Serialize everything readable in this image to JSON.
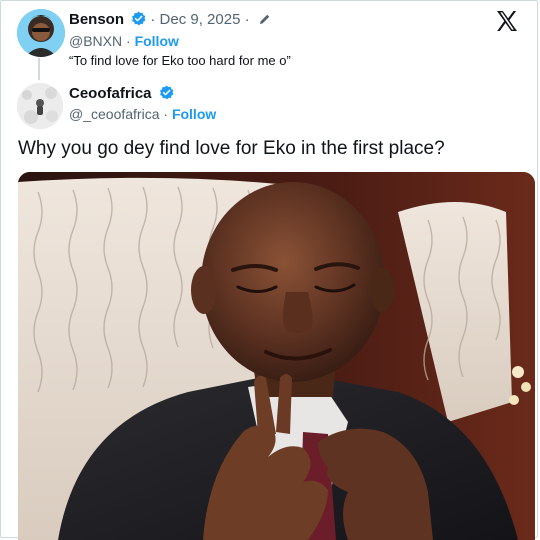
{
  "reply": {
    "name": "Benson",
    "date": "Dec 9, 2025",
    "separator": "·",
    "handle": "@BNXN",
    "follow_label": "Follow",
    "text": "“To find love for Eko too hard for me o”"
  },
  "tweet": {
    "name": "Ceoofafrica",
    "handle": "@_ceoofafrica",
    "separator": "·",
    "follow_label": "Follow",
    "text": "Why you go dey find love for Eko in the first place?"
  },
  "icons": {
    "brand": "x-logo-icon",
    "verified": "verified-badge-icon",
    "edited": "pencil-icon"
  },
  "colors": {
    "link": "#1d9bf0",
    "verified": "#1d9bf0",
    "muted": "#536471",
    "text": "#0f1419",
    "border": "#cfd9de"
  }
}
